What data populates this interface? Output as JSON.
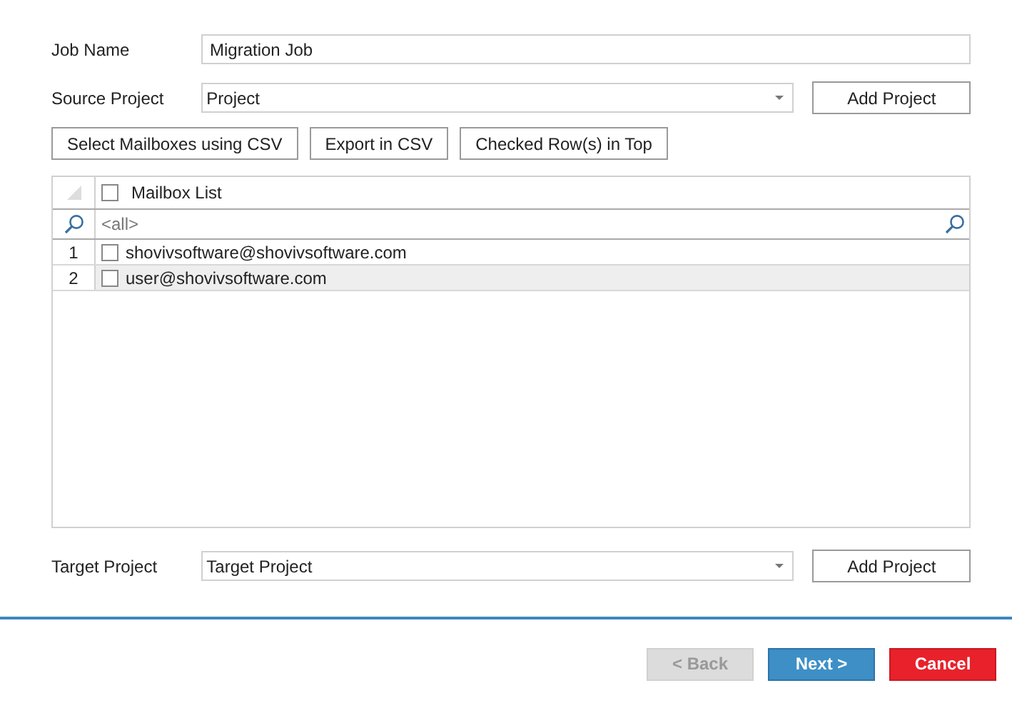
{
  "job_name": {
    "label": "Job Name",
    "value": "Migration Job"
  },
  "source_project": {
    "label": "Source Project",
    "value": "Project",
    "button": "Add Project"
  },
  "toolbar": [
    "Select Mailboxes using CSV",
    "Export in CSV",
    "Checked Row(s) in Top"
  ],
  "grid": {
    "column": "Mailbox List",
    "header_checked": false,
    "filter": "<all>",
    "rows": [
      {
        "number": "1",
        "email": "shovivsoftware@shovivsoftware.com",
        "checked": false,
        "selected": false
      },
      {
        "number": "2",
        "email": "user@shovivsoftware.com",
        "checked": false,
        "selected": true
      }
    ]
  },
  "target_project": {
    "label": "Target Project",
    "value": "Target Project",
    "button": "Add Project"
  },
  "footer": [
    {
      "label": "< Back",
      "kind": "back",
      "disabled": true
    },
    {
      "label": "Next >",
      "kind": "next",
      "disabled": false
    },
    {
      "label": "Cancel",
      "kind": "cancel",
      "disabled": false
    }
  ]
}
